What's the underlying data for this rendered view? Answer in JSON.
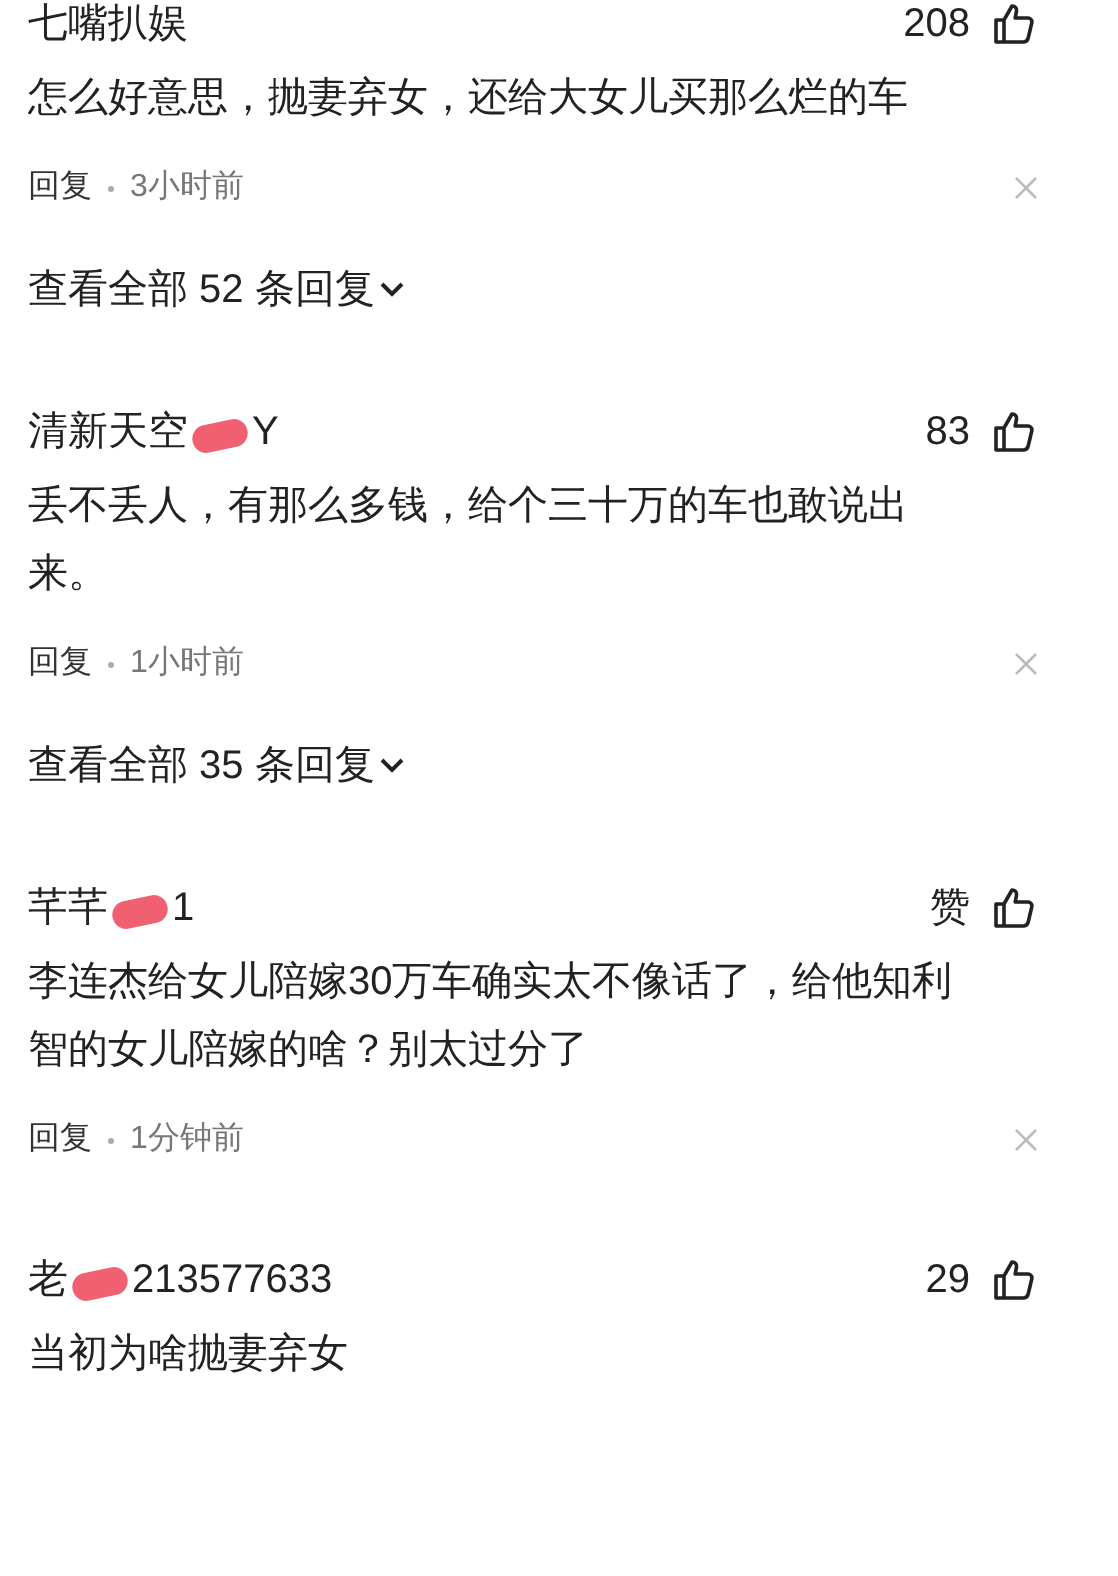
{
  "comments": [
    {
      "name": "七嘴扒娱",
      "redacted": false,
      "likes": "208",
      "lines": [
        "怎么好意思，抛妻弃女，还给大女儿买那么烂的车"
      ],
      "reply": "回复",
      "time": "3小时前",
      "view_all": "查看全部 52 条回复"
    },
    {
      "name": "清新天空",
      "redacted": true,
      "name_suffix": "Y",
      "likes": "83",
      "lines": [
        "丢不丢人，有那么多钱，给个三十万的车也敢说出",
        "来。"
      ],
      "reply": "回复",
      "time": "1小时前",
      "view_all": "查看全部 35 条回复"
    },
    {
      "name": "芊芊",
      "redacted": true,
      "name_suffix": "1",
      "likes": "赞",
      "lines": [
        "李连杰给女儿陪嫁30万车确实太不像话了，给他知利",
        "智的女儿陪嫁的啥？别太过分了"
      ],
      "reply": "回复",
      "time": "1分钟前"
    },
    {
      "name": "老",
      "redacted": true,
      "name_suffix": "213577633",
      "likes": "29",
      "lines": [
        "当初为啥抛妻弃女"
      ]
    }
  ]
}
